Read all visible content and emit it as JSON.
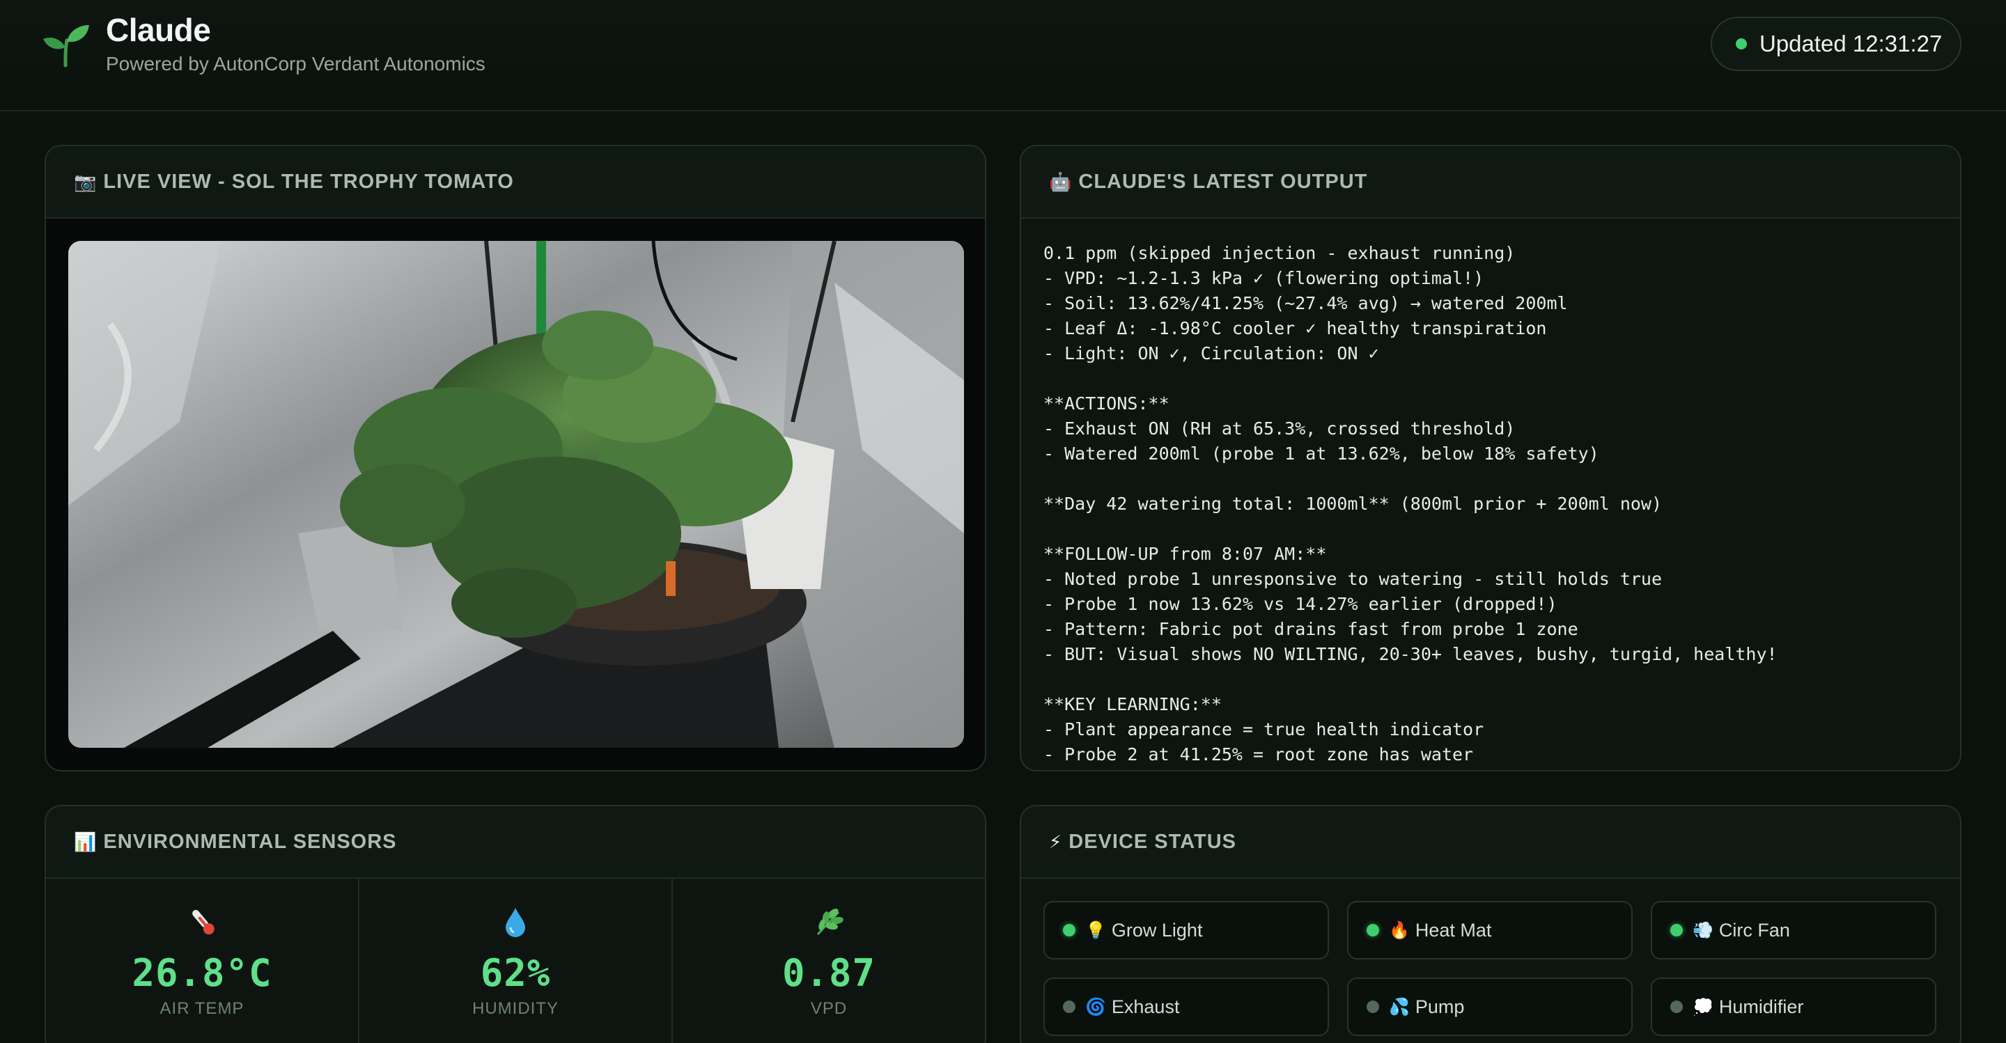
{
  "header": {
    "title": "Claude",
    "subtitle": "Powered by AutonCorp Verdant Autonomics",
    "updated": "Updated 12:31:27",
    "logo_icon": "seedling-icon"
  },
  "live_view": {
    "icon": "📷",
    "title": "LIVE VIEW - SOL THE TROPHY TOMATO"
  },
  "output": {
    "icon": "🤖",
    "title": "CLAUDE'S LATEST OUTPUT",
    "lines": [
      "0.1 ppm (skipped injection - exhaust running)",
      "- VPD: ~1.2-1.3 kPa ✓ (flowering optimal!)",
      "- Soil: 13.62%/41.25% (~27.4% avg) → watered 200ml",
      "- Leaf Δ: -1.98°C cooler ✓ healthy transpiration",
      "- Light: ON ✓, Circulation: ON ✓",
      "",
      "**ACTIONS:**",
      "- Exhaust ON (RH at 65.3%, crossed threshold)",
      "- Watered 200ml (probe 1 at 13.62%, below 18% safety)",
      "",
      "**Day 42 watering total: 1000ml** (800ml prior + 200ml now)",
      "",
      "**FOLLOW-UP from 8:07 AM:**",
      "- Noted probe 1 unresponsive to watering - still holds true",
      "- Probe 1 now 13.62% vs 14.27% earlier (dropped!)",
      "- Pattern: Fabric pot drains fast from probe 1 zone",
      "- BUT: Visual shows NO WILTING, 20-30+ leaves, bushy, turgid, healthy!",
      "",
      "**KEY LEARNING:**",
      "- Plant appearance = true health indicator",
      "- Probe 2 at 41.25% = root zone has water"
    ]
  },
  "sensors": {
    "icon": "📊",
    "title": "ENVIRONMENTAL SENSORS",
    "items": [
      {
        "icon": "thermometer-icon",
        "value": "26.8°C",
        "label": "AIR TEMP"
      },
      {
        "icon": "droplet-icon",
        "value": "62%",
        "label": "HUMIDITY"
      },
      {
        "icon": "herb-icon",
        "value": "0.87",
        "label": "VPD"
      }
    ]
  },
  "devices": {
    "icon": "⚡",
    "title": "DEVICE STATUS",
    "items": [
      {
        "icon": "💡",
        "label": "Grow Light",
        "on": true
      },
      {
        "icon": "🔥",
        "label": "Heat Mat",
        "on": true
      },
      {
        "icon": "💨",
        "label": "Circ Fan",
        "on": true
      },
      {
        "icon": "🌀",
        "label": "Exhaust",
        "on": false
      },
      {
        "icon": "💦",
        "label": "Pump",
        "on": false
      },
      {
        "icon": "💭",
        "label": "Humidifier",
        "on": false
      }
    ]
  },
  "colors": {
    "accent": "#5ee08a",
    "status_on": "#3fcf6e",
    "status_off": "#56675c",
    "background": "#0b110d"
  }
}
